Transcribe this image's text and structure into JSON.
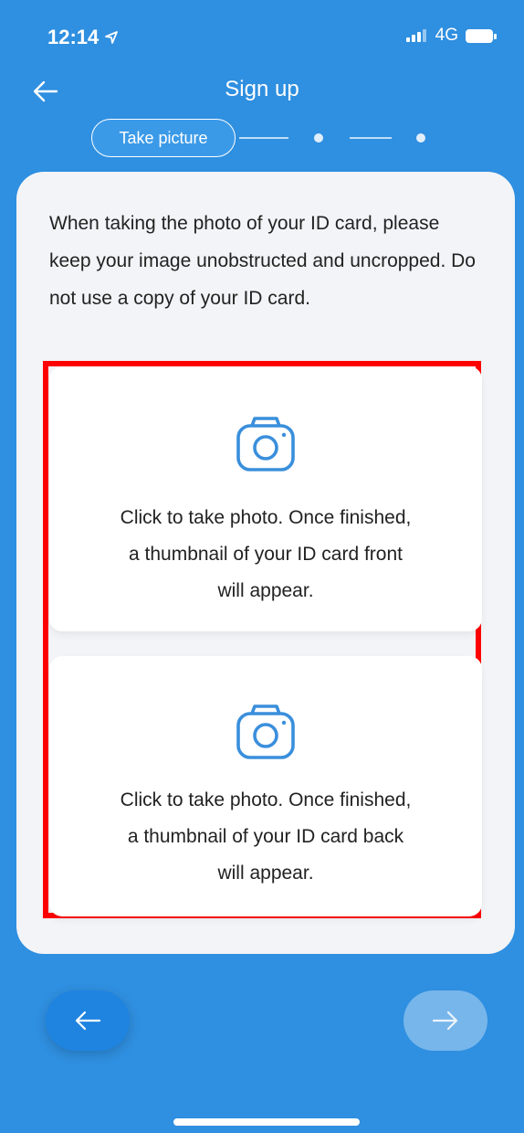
{
  "status_bar": {
    "time": "12:14",
    "network": "4G"
  },
  "nav": {
    "title": "Sign up",
    "back_icon": "arrow-left-icon"
  },
  "stepper": {
    "current_step_label": "Take picture"
  },
  "instructions": "When taking the photo of your ID card, please keep your image unobstructed and uncropped. Do not use a copy of your ID card.",
  "photo_cards": {
    "front": {
      "text": "Click to take photo. Once finished,\na thumbnail of your ID card front\nwill appear."
    },
    "back": {
      "text": "Click to take photo. Once finished,\na thumbnail of your ID card back\nwill appear."
    }
  },
  "buttons": {
    "prev_icon": "arrow-left-icon",
    "next_icon": "arrow-right-icon"
  },
  "colors": {
    "background": "#2f8fe0",
    "card": "#f3f4f7",
    "highlight": "#ff0000",
    "icon": "#3a8fdc"
  }
}
